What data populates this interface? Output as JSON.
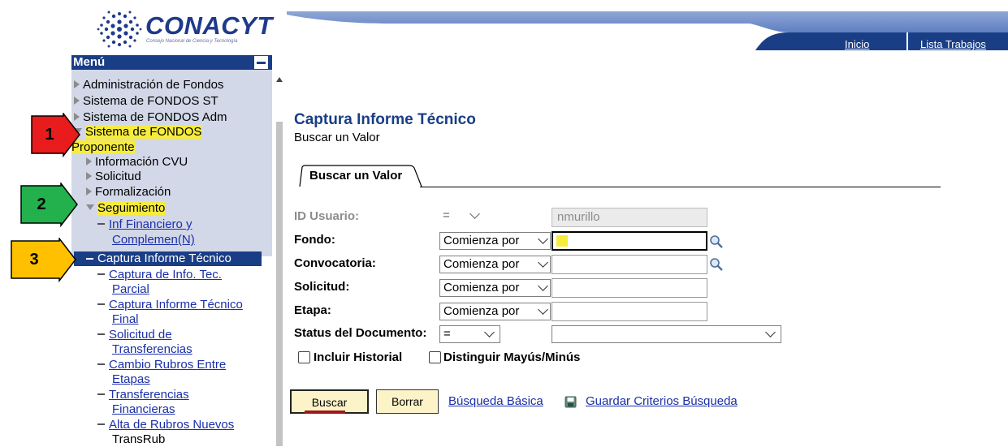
{
  "header": {
    "logo_text": "CONACYT",
    "logo_subtitle": "Consejo Nacional de Ciencia y Tecnología",
    "nav": [
      {
        "label": "Inicio"
      },
      {
        "label": "Lista Trabajos"
      }
    ]
  },
  "menu": {
    "title": "Menú",
    "items": [
      {
        "label": "Administración de Fondos"
      },
      {
        "label": "Sistema de FONDOS ST"
      },
      {
        "label": "Sistema de FONDOS Adm"
      },
      {
        "label": "Sistema de FONDOS"
      },
      {
        "label": "Proponente"
      },
      {
        "label": "Información CVU"
      },
      {
        "label": "Solicitud"
      },
      {
        "label": "Formalización"
      },
      {
        "label": "Seguimiento"
      }
    ],
    "subitems": [
      {
        "line1": "Inf Financiero y",
        "line2": "Complemen(N)"
      },
      {
        "line1": "Captura Informe Técnico"
      },
      {
        "line1": "Captura de Info. Tec.",
        "line2": "Parcial"
      },
      {
        "line1": "Captura Informe Técnico",
        "line2": "Final"
      },
      {
        "line1": "Solicitud de",
        "line2": "Transferencias"
      },
      {
        "line1": "Cambio Rubros Entre",
        "line2": "Etapas"
      },
      {
        "line1": "Transferencias",
        "line2": "Financieras"
      },
      {
        "line1": "Alta de Rubros Nuevos",
        "line2": "TransRub"
      }
    ]
  },
  "callouts": [
    {
      "number": "1",
      "color": "#e81c1c"
    },
    {
      "number": "2",
      "color": "#22b14c"
    },
    {
      "number": "3",
      "color": "#ffc000"
    }
  ],
  "page": {
    "title": "Captura Informe Técnico",
    "subtitle": "Buscar un Valor",
    "tab": "Buscar un Valor"
  },
  "form": {
    "fields": [
      {
        "label": "ID Usuario:",
        "operator": "=",
        "value": "nmurillo"
      },
      {
        "label": "Fondo:",
        "operator": "Comienza por",
        "value": ""
      },
      {
        "label": "Convocatoria:",
        "operator": "Comienza por",
        "value": ""
      },
      {
        "label": "Solicitud:",
        "operator": "Comienza por",
        "value": ""
      },
      {
        "label": "Etapa:",
        "operator": "Comienza por",
        "value": ""
      },
      {
        "label": "Status del Documento:",
        "operator": "=",
        "value": ""
      }
    ],
    "checkboxes": [
      {
        "label": "Incluir Historial",
        "checked": false
      },
      {
        "label": "Distinguir Mayús/Minús",
        "checked": false
      }
    ]
  },
  "actions": {
    "buscar": "Buscar",
    "borrar": "Borrar",
    "busqueda_basica": "Búsqueda Básica",
    "guardar_criterios": "Guardar Criterios Búsqueda"
  },
  "colors": {
    "accent": "#1a3e86",
    "highlight": "#f7ec3b",
    "button_bg": "#fdf3c8"
  }
}
